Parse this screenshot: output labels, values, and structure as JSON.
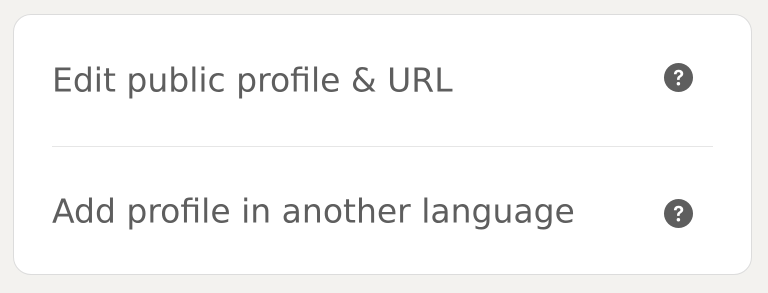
{
  "profile_menu": {
    "items": [
      {
        "label": "Edit public profile & URL",
        "icon": "question-circle-icon"
      },
      {
        "label": "Add profile in another language",
        "icon": "question-circle-icon"
      }
    ]
  },
  "colors": {
    "page_background": "#f3f2ef",
    "card_background": "#ffffff",
    "text": "#5e5e5e",
    "icon": "#5e5e5e"
  }
}
